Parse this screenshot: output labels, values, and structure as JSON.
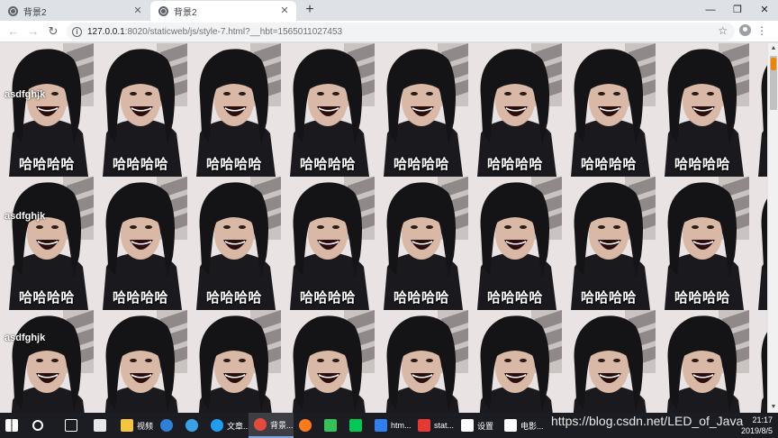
{
  "tabs": [
    {
      "title": "背景2",
      "active": false
    },
    {
      "title": "背景2",
      "active": true
    }
  ],
  "toolbar": {
    "url_host": "127.0.0.1",
    "url_rest": ":8020/staticweb/js/style-7.html?__hbt=1565011027453"
  },
  "page": {
    "text_lines": [
      "asdfghjk",
      "asdfghjk",
      "asdfghjk"
    ],
    "tile_caption": "哈哈哈哈",
    "tile_columns": 9,
    "tile_rows": 3
  },
  "taskbar": {
    "items": [
      {
        "label": "",
        "icon": "windows-start-icon"
      },
      {
        "label": "",
        "icon": "cortana-search-icon"
      },
      {
        "label": "",
        "icon": "task-view-icon"
      },
      {
        "label": "",
        "icon": "mail-icon"
      },
      {
        "label": "视频",
        "icon": "folder-icon"
      },
      {
        "label": "",
        "icon": "edge-icon"
      },
      {
        "label": "",
        "icon": "ie-icon"
      },
      {
        "label": "文章...",
        "icon": "qq-browser-icon"
      },
      {
        "label": "背景...",
        "icon": "chrome-icon"
      },
      {
        "label": "",
        "icon": "firefox-icon"
      },
      {
        "label": "",
        "icon": "media-player-icon"
      },
      {
        "label": "",
        "icon": "iqiyi-icon"
      },
      {
        "label": "htm...",
        "icon": "vscode-icon"
      },
      {
        "label": "stat...",
        "icon": "hbuilder-icon"
      },
      {
        "label": "设置",
        "icon": "gear-icon"
      },
      {
        "label": "电影...",
        "icon": "movie-icon"
      }
    ],
    "clock_time": "21:17",
    "clock_date": "2019/8/5"
  },
  "watermark": "https://blog.csdn.net/LED_of_Java",
  "colors": {
    "tab_strip": "#dee1e6",
    "taskbar": "#1c1d22",
    "scroll_thumb_accent": "#f08300"
  }
}
